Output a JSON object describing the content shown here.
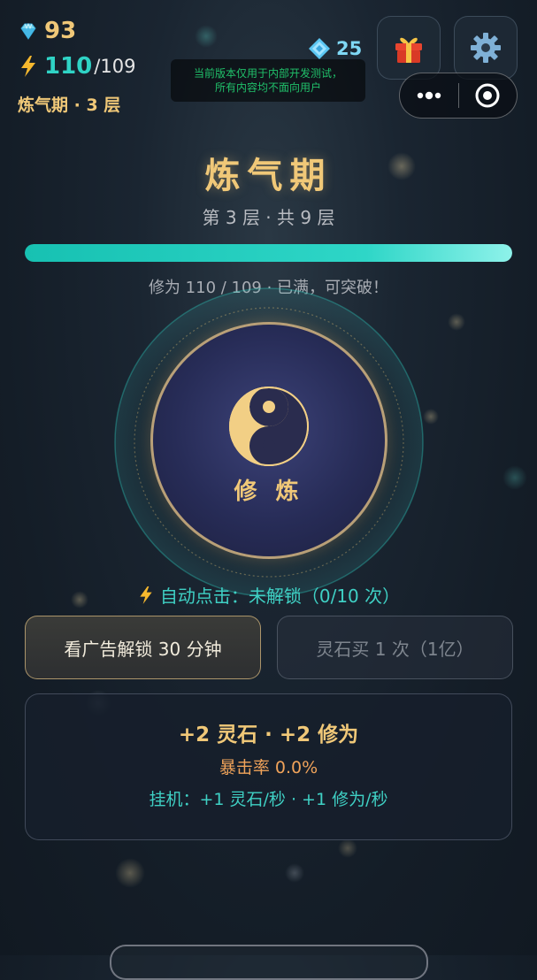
{
  "stats": {
    "diamonds": "93",
    "energy_current": "110",
    "energy_max": "/109",
    "realm_short": "炼气期 · 3 层",
    "crystals": "25"
  },
  "notice": {
    "line1": "当前版本仅用于内部开发测试，",
    "line2": "所有内容均不面向用户"
  },
  "icons": {
    "diamond": "diamond-icon",
    "energy": "lightning-icon",
    "crystal": "crystal-icon",
    "gift": "gift-icon",
    "settings": "gear-icon",
    "more": "more-dots-icon",
    "record": "target-icon",
    "yinyang": "yinyang-icon"
  },
  "realm": {
    "title": "炼气期",
    "layer": "第 3 层 · 共 9 层",
    "progress_text": "修为 110 / 109 · 已满，可突破！",
    "progress": 1.0
  },
  "cultivate": {
    "label": "修 炼"
  },
  "auto_click": {
    "text": "自动点击：未解锁（0/10 次）"
  },
  "buttons": {
    "watch_ad": "看广告解锁 30 分钟",
    "buy_spirit_stone": "灵石买 1 次（1亿）"
  },
  "gains": {
    "line1": "+2 灵石 · +2 修为",
    "crit": "暴击率 0.0%",
    "idle": "挂机：+1 灵石/秒 · +1 修为/秒"
  },
  "colors": {
    "gold": "#f0c878",
    "teal": "#2fd3c5",
    "background": "#18222d"
  }
}
